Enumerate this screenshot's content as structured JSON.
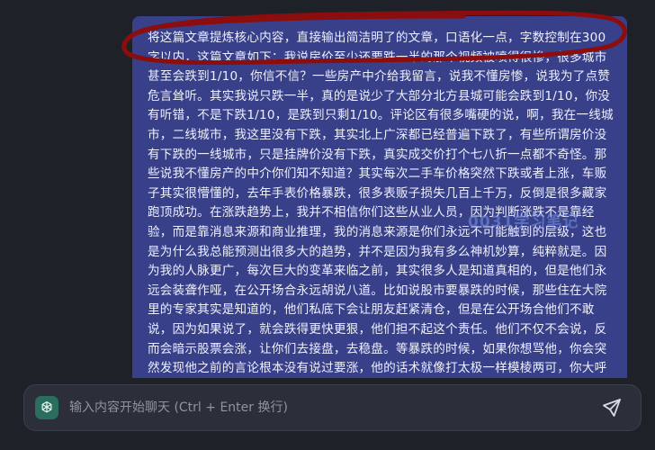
{
  "message": {
    "text": "将这篇文章提炼核心内容，直接输出简洁明了的文章，口语化一点，字数控制在300字以内，这篇文章如下：我说房价至少还要跌一半的那个视频被喷得很惨，很多城市甚至会跌到1/10，你信不信？一些房产中介给我留言，说我不懂房惨，说我为了点赞危言耸听。其实我说只跌一半，真的是说少了大部分北方县城可能会跌到1/10，你没有听错，不是下跌1/10，是跌到只剩1/10。评论区有很多嘴硬的说，啊，我在一线城市，二线城市，我这里没有下跌，其实北上广深都已经普遍下跌了，有些所谓房价没有下跌的一线城市，只是挂牌价没有下跌，真实成交价打个七八折一点都不奇怪。那些说我不懂房产的中介你们知不知道？其实每次二手车价格突然下跌或者上涨，车贩子其实很懵懂的，去年手表价格暴跌，很多表贩子损失几百上千万，反倒是很多藏家跑顶成功。在涨跌趋势上，我并不相信你们这些从业人员，因为判断涨跌不是靠经验，而是靠消息来源和商业推理，我的消息来源是你们永远不可能触到的层级，这也是为什么我总能预测出很多大的趋势，并不是因为我有多么神机妙算，纯粹就是。因为我的人脉更广，每次巨大的变革来临之前，其实很多人是知道真相的，但是他们永远会装聋作哑，在公开场合永远胡说八道。比如说股市要暴跌的时候，那些住在大院里的专家其实是知道的，他们私底下会让朋友赶紧清仓，但是在公开场合他们不敢说，因为如果说了，就会跌得更快更狠，他们担不起这个责任。他们不仅不会说，反而会暗示股票会涨，让你们去接盘，去稳盘。等暴跌的时候，如果你想骂他，你会突然发现他之前的言论根本没有说过要涨，他的话术就像打太极一样模棱两可，你大呼上当，但是毫无办法，这其实也不能怪他们，这也是他们的职责所在。但是老百姓就活该做韭菜吗？直话是不是总得有人出来说，我提前一年跟大家预测了疫情放"
  },
  "watermark": {
    "text": "0031学习笔记"
  },
  "input": {
    "placeholder": "输入内容开始聊天 (Ctrl + Enter 换行)",
    "value": ""
  },
  "icons": {
    "model": "openai-logo-icon",
    "send": "send-icon"
  },
  "colors": {
    "background": "#1f2129",
    "bubble": "#384089",
    "annotation": "#8b0d0d",
    "input_bar": "#2c2f3a"
  }
}
